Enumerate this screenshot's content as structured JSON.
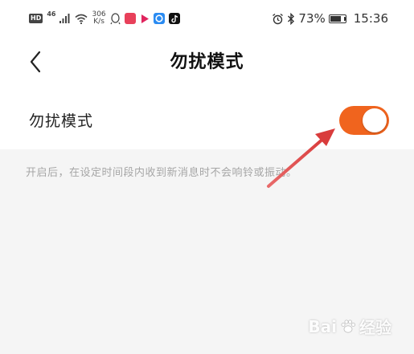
{
  "status_bar": {
    "hd": "HD",
    "network_type": "46",
    "speed_value": "306",
    "speed_unit": "K/s",
    "battery": "73%",
    "time": "15:36",
    "icons": [
      "hd-icon",
      "signal-icon",
      "wifi-icon",
      "qq-icon",
      "app-red-icon",
      "play-icon",
      "app-circle-icon",
      "tiktok-icon",
      "alarm-icon",
      "bluetooth-icon",
      "battery-icon"
    ]
  },
  "nav": {
    "back_icon": "back-chevron-icon",
    "title": "勿扰模式"
  },
  "setting": {
    "label": "勿扰模式",
    "toggle_on": true,
    "toggle_color": "#f0641e"
  },
  "description": {
    "text": "开启后，在设定时间段内收到新消息时不会响铃或振动。"
  },
  "annotation": {
    "arrow_color": "#e24a4a"
  },
  "watermark": {
    "brand": "Bai",
    "brand_suffix": "经验",
    "sub": "jingyan.baidu.com"
  }
}
